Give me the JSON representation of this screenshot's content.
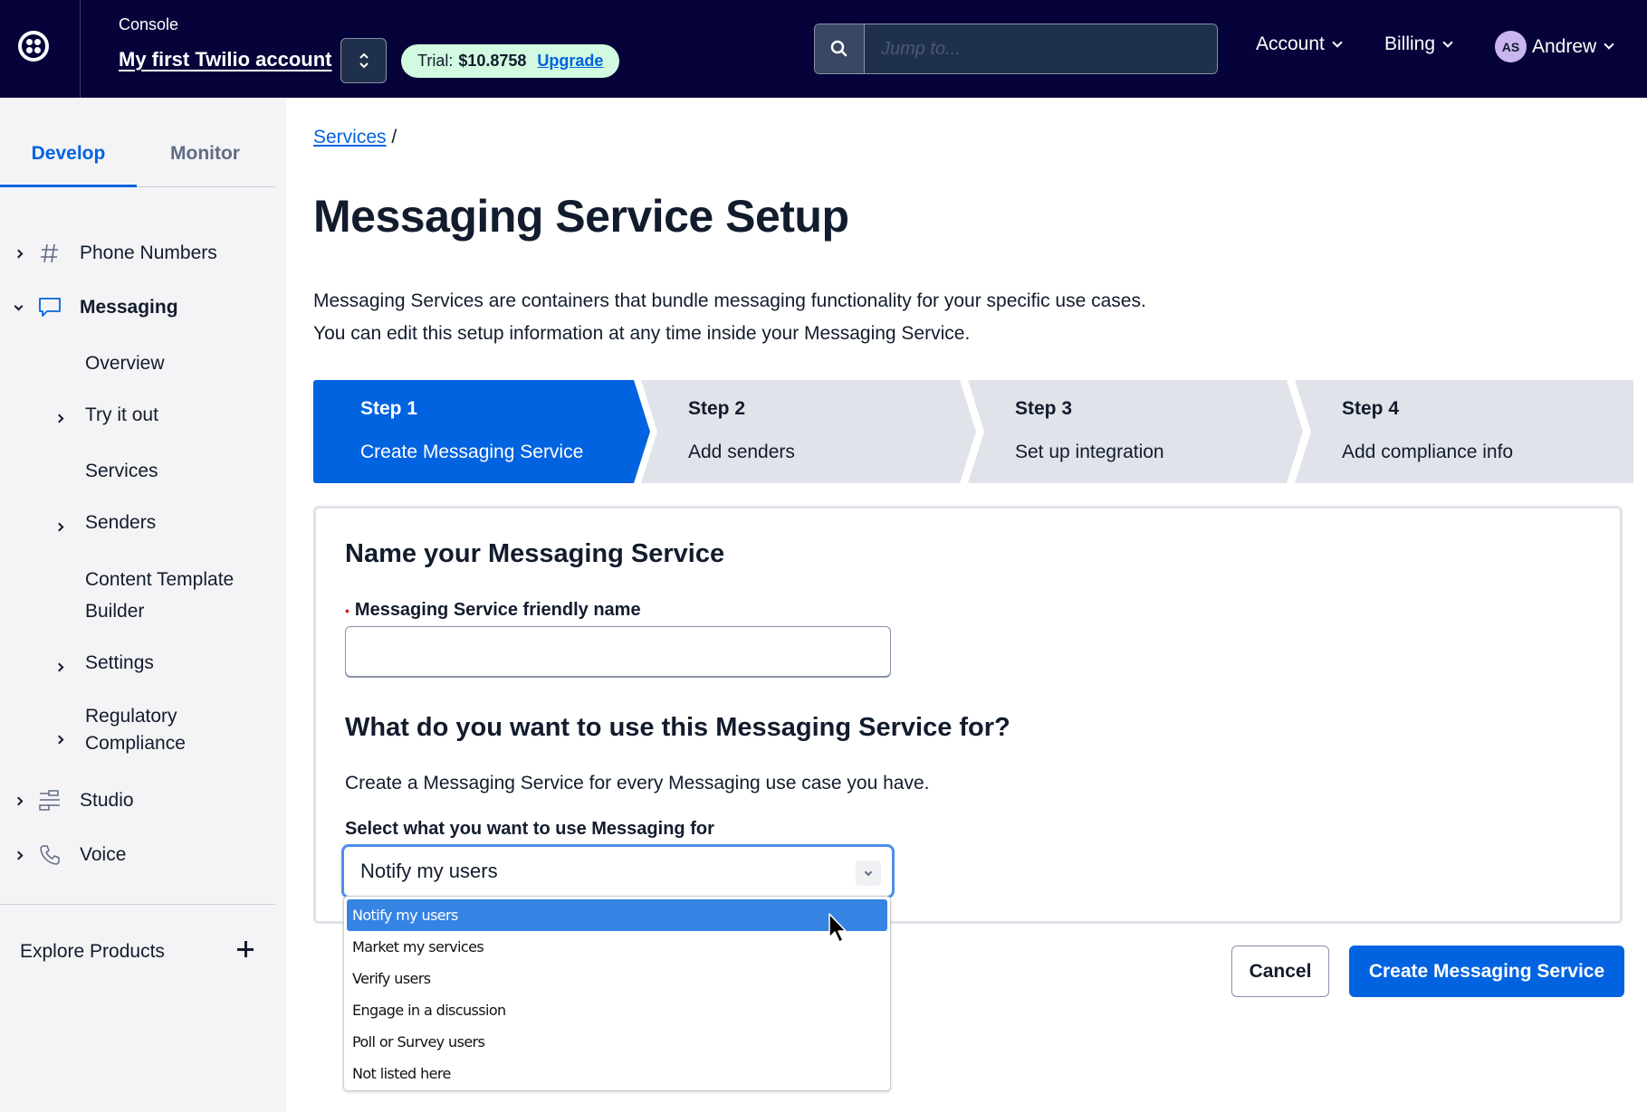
{
  "header": {
    "console_label": "Console",
    "account_name": "My first Twilio account",
    "trial": {
      "label": "Trial:",
      "amount": "$10.8758",
      "upgrade_label": "Upgrade"
    },
    "search": {
      "placeholder": "Jump to...",
      "value": ""
    },
    "menus": [
      {
        "label": "Account"
      },
      {
        "label": "Billing"
      }
    ],
    "user": {
      "initials": "AS",
      "name": "Andrew"
    },
    "colors": {
      "background": "#06033a",
      "trial_pill": "#d1fae0",
      "avatar": "#cbb5f0"
    }
  },
  "sidebar": {
    "tabs": [
      {
        "label": "Develop",
        "active": true
      },
      {
        "label": "Monitor",
        "active": false
      }
    ],
    "items": [
      {
        "label": "Phone Numbers",
        "icon": "hash-icon",
        "expanded": false
      },
      {
        "label": "Messaging",
        "icon": "chat-bubble-icon",
        "expanded": true,
        "active": true
      },
      {
        "label": "Studio",
        "icon": "studio-flow-icon",
        "expanded": false
      },
      {
        "label": "Voice",
        "icon": "phone-icon",
        "expanded": false
      }
    ],
    "messaging_sub": [
      {
        "label": "Overview",
        "has_children": false
      },
      {
        "label": "Try it out",
        "has_children": true
      },
      {
        "label": "Services",
        "has_children": false
      },
      {
        "label": "Senders",
        "has_children": true
      },
      {
        "label": "Content Template Builder",
        "line1": "Content Template",
        "line2": "Builder",
        "has_children": false
      },
      {
        "label": "Settings",
        "has_children": true
      },
      {
        "label": "Regulatory Compliance",
        "line1": "Regulatory",
        "line2": "Compliance",
        "has_children": true
      }
    ],
    "explore_label": "Explore Products"
  },
  "main": {
    "breadcrumb": {
      "link": "Services",
      "separator": "/"
    },
    "title": "Messaging Service Setup",
    "intro_line1": "Messaging Services are containers that bundle messaging functionality for your specific use cases.",
    "intro_line2": "You can edit this setup information at any time inside your Messaging Service.",
    "steps": [
      {
        "num": "Step 1",
        "label": "Create Messaging Service",
        "active": true
      },
      {
        "num": "Step 2",
        "label": "Add senders",
        "active": false
      },
      {
        "num": "Step 3",
        "label": "Set up integration",
        "active": false
      },
      {
        "num": "Step 4",
        "label": "Add compliance info",
        "active": false
      }
    ],
    "form": {
      "name_section_title": "Name your Messaging Service",
      "name_label": "Messaging Service friendly name",
      "name_required_marker": "•",
      "name_value": "",
      "use_section_title": "What do you want to use this Messaging Service for?",
      "use_helper": "Create a Messaging Service for every Messaging use case you have.",
      "use_label": "Select what you want to use Messaging for",
      "use_selected": "Notify my users",
      "use_options": [
        "Notify my users",
        "Market my services",
        "Verify users",
        "Engage in a discussion",
        "Poll or Survey users",
        "Not listed here"
      ],
      "highlighted_option_index": 0
    },
    "buttons": {
      "cancel": "Cancel",
      "create": "Create Messaging Service"
    },
    "colors": {
      "primary": "#0263e0",
      "step_inactive": "#e1e3ea",
      "required": "#d61f1f",
      "dropdown_highlight": "#3584e4"
    }
  }
}
